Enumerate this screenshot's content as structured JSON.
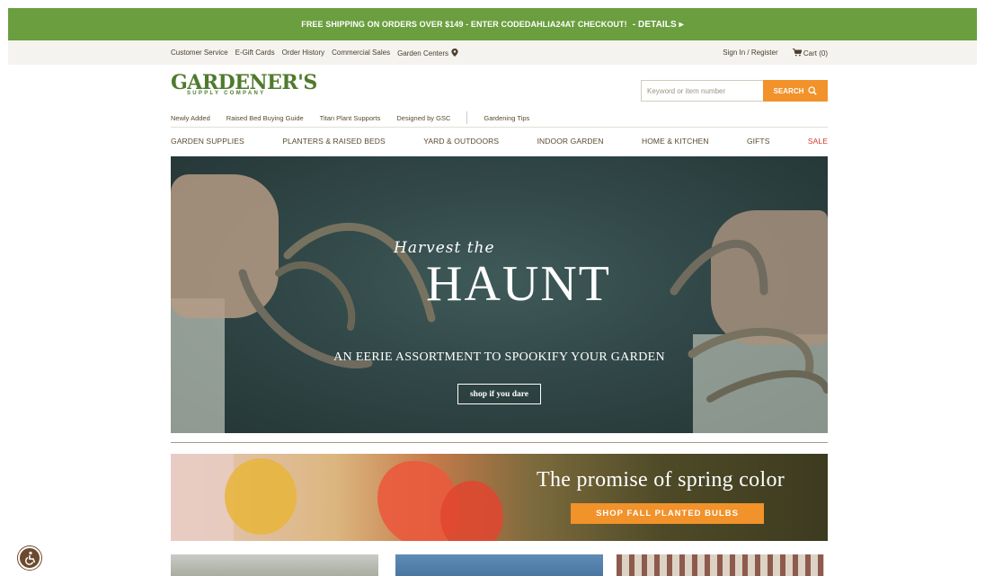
{
  "promo": {
    "text_before": "FREE SHIPPING ON ORDERS OVER $149 - ENTER CODE ",
    "code": "DAHLIA24",
    "text_after": " AT CHECKOUT!",
    "details": "- DETAILS ▸"
  },
  "utility": {
    "left": [
      "Customer Service",
      "E-Gift Cards",
      "Order History",
      "Commercial Sales",
      "Garden Centers"
    ],
    "sign_in": "Sign In / Register",
    "cart": "Cart (0)"
  },
  "logo": {
    "word": "GARDENER'S",
    "sub": "SUPPLY COMPANY"
  },
  "search": {
    "placeholder": "Keyword or item number",
    "button": "SEARCH"
  },
  "subnav": [
    "Newly Added",
    "Raised Bed Buying Guide",
    "Titan Plant Supports",
    "Designed by GSC",
    "Gardening Tips"
  ],
  "mainnav": [
    "GARDEN SUPPLIES",
    "PLANTERS & RAISED BEDS",
    "YARD & OUTDOORS",
    "INDOOR GARDEN",
    "HOME & KITCHEN",
    "GIFTS",
    "SALE"
  ],
  "hero": {
    "title_small": "Harvest the",
    "title_big": "HAUNT",
    "subtitle": "AN EERIE ASSORTMENT TO SPOOKIFY YOUR GARDEN",
    "button": "shop if you dare"
  },
  "spring": {
    "title": "The promise of spring color",
    "button": "SHOP FALL PLANTED BULBS"
  },
  "colors": {
    "promo_green": "#6a9e3f",
    "accent_orange": "#f2922a",
    "sale_red": "#d23a2a",
    "brand_green": "#4f7a2e"
  }
}
